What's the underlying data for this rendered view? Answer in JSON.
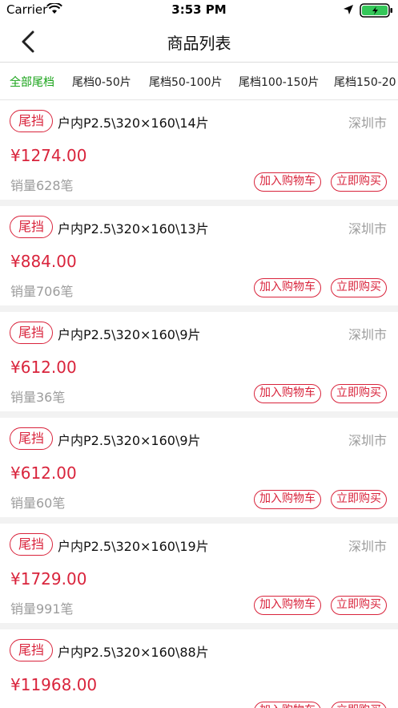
{
  "status": {
    "carrier": "Carrier",
    "time": "3:53 PM"
  },
  "nav": {
    "title": "商品列表"
  },
  "filters": [
    {
      "label": "全部尾档",
      "active": true
    },
    {
      "label": "尾档0-50片",
      "active": false
    },
    {
      "label": "尾档50-100片",
      "active": false
    },
    {
      "label": "尾档100-150片",
      "active": false
    },
    {
      "label": "尾档150-20",
      "active": false
    }
  ],
  "colors": {
    "accent_red": "#d9243c",
    "active_green": "#19a319",
    "muted_gray": "#9c9c9c"
  },
  "products": [
    {
      "tag": "尾挡",
      "title": "户内P2.5\\320×160\\14片",
      "city": "深圳市",
      "price": "¥1274.00",
      "sales": "销量628笔",
      "cart_label": "加入购物车",
      "buy_label": "立即购买"
    },
    {
      "tag": "尾挡",
      "title": "户内P2.5\\320×160\\13片",
      "city": "深圳市",
      "price": "¥884.00",
      "sales": "销量706笔",
      "cart_label": "加入购物车",
      "buy_label": "立即购买"
    },
    {
      "tag": "尾挡",
      "title": "户内P2.5\\320×160\\9片",
      "city": "深圳市",
      "price": "¥612.00",
      "sales": "销量36笔",
      "cart_label": "加入购物车",
      "buy_label": "立即购买"
    },
    {
      "tag": "尾挡",
      "title": "户内P2.5\\320×160\\9片",
      "city": "深圳市",
      "price": "¥612.00",
      "sales": "销量60笔",
      "cart_label": "加入购物车",
      "buy_label": "立即购买"
    },
    {
      "tag": "尾挡",
      "title": "户内P2.5\\320×160\\19片",
      "city": "深圳市",
      "price": "¥1729.00",
      "sales": "销量991笔",
      "cart_label": "加入购物车",
      "buy_label": "立即购买"
    },
    {
      "tag": "尾挡",
      "title": "户内P2.5\\320×160\\88片",
      "city": "",
      "price": "¥11968.00",
      "sales": "",
      "cart_label": "加入购物车",
      "buy_label": "立即购买"
    }
  ]
}
